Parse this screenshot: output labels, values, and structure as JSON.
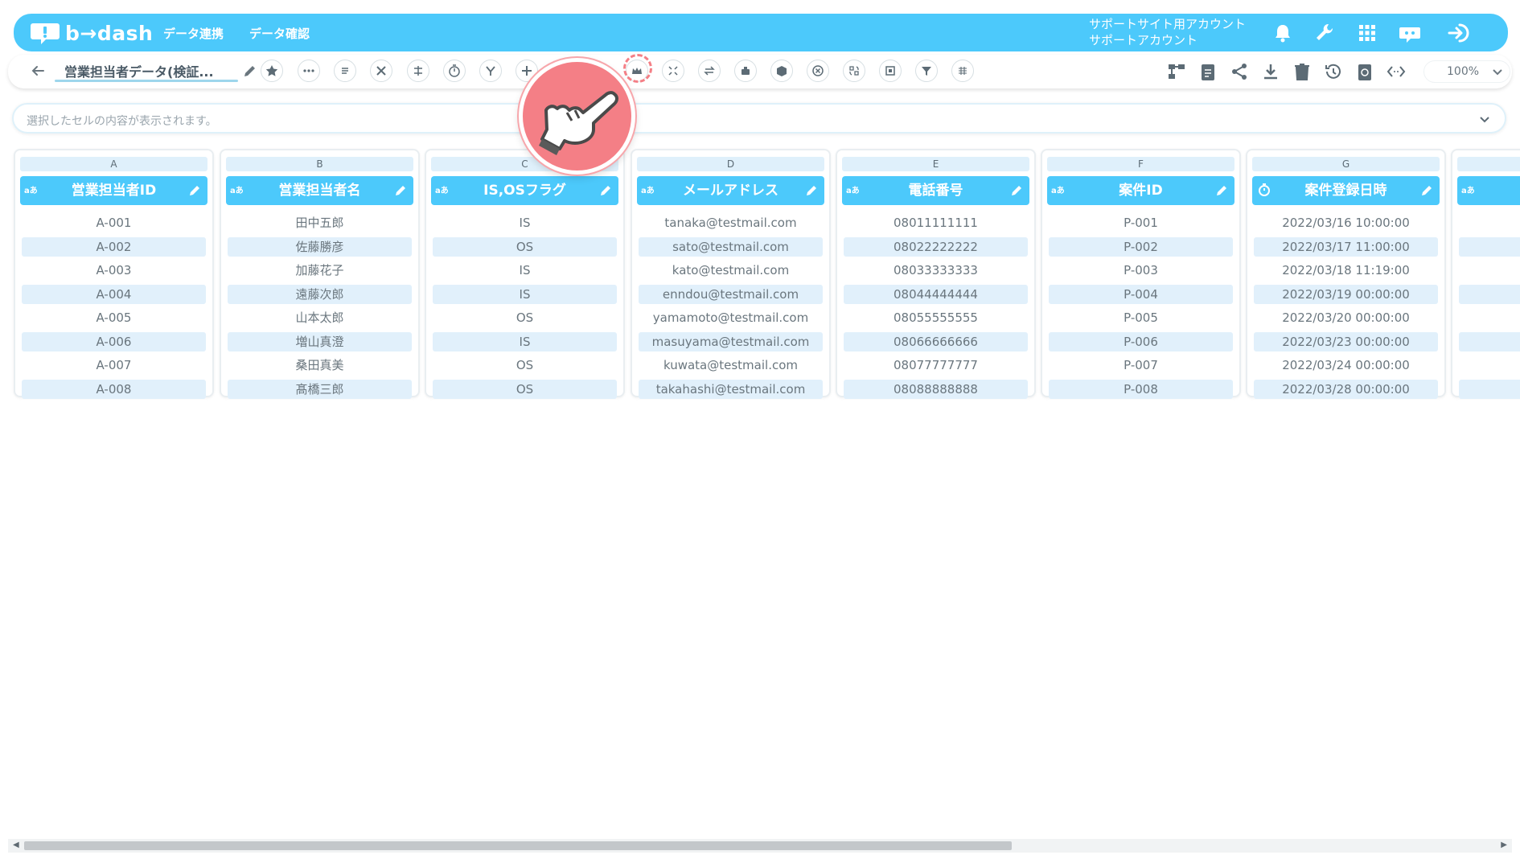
{
  "header": {
    "logo_text": "b→dash",
    "nav": [
      "データ連携",
      "データ確認"
    ],
    "account_line1": "サポートサイト用アカウント",
    "account_line2": "サポートアカウント",
    "icons": [
      "bell-icon",
      "wrench-icon",
      "apps-grid-icon",
      "chat-robot-icon",
      "logout-icon"
    ]
  },
  "toolbar": {
    "title": "営業担当者データ(検証...",
    "zoom": "100%",
    "left_icons": [
      "star-icon",
      "more-icon",
      "list-icon",
      "tools-icon",
      "merge-icon",
      "timer-icon",
      "branch-icon",
      "plus-icon",
      "link-icon",
      "crown-icon",
      "expand-icon",
      "swap-icon",
      "combine-icon",
      "box-icon",
      "cancel-icon",
      "replace-icon",
      "frame-icon",
      "filter-icon",
      "calendar-icon"
    ],
    "right_icons": [
      "flow-icon",
      "clipboard-icon",
      "share-icon",
      "download-icon",
      "trash-icon",
      "history-icon",
      "refresh-doc-icon",
      "code-icon"
    ]
  },
  "formula_bar": {
    "placeholder": "選択したセルの内容が表示されます。"
  },
  "columns": [
    {
      "letter": "A",
      "type": "aあ",
      "name": "営業担当者ID",
      "values": [
        "A-001",
        "A-002",
        "A-003",
        "A-004",
        "A-005",
        "A-006",
        "A-007",
        "A-008"
      ]
    },
    {
      "letter": "B",
      "type": "aあ",
      "name": "営業担当者名",
      "values": [
        "田中五郎",
        "佐藤勝彦",
        "加藤花子",
        "遠藤次郎",
        "山本太郎",
        "増山真澄",
        "桑田真美",
        "髙橋三郎"
      ]
    },
    {
      "letter": "C",
      "type": "aあ",
      "name": "IS,OSフラグ",
      "values": [
        "IS",
        "OS",
        "IS",
        "IS",
        "OS",
        "IS",
        "OS",
        "OS"
      ]
    },
    {
      "letter": "D",
      "type": "aあ",
      "name": "メールアドレス",
      "values": [
        "tanaka@testmail.com",
        "sato@testmail.com",
        "kato@testmail.com",
        "enndou@testmail.com",
        "yamamoto@testmail.com",
        "masuyama@testmail.com",
        "kuwata@testmail.com",
        "takahashi@testmail.com"
      ]
    },
    {
      "letter": "E",
      "type": "aあ",
      "name": "電話番号",
      "values": [
        "08011111111",
        "08022222222",
        "08033333333",
        "08044444444",
        "08055555555",
        "08066666666",
        "08077777777",
        "08088888888"
      ]
    },
    {
      "letter": "F",
      "type": "aあ",
      "name": "案件ID",
      "values": [
        "P-001",
        "P-002",
        "P-003",
        "P-004",
        "P-005",
        "P-006",
        "P-007",
        "P-008"
      ]
    },
    {
      "letter": "G",
      "type": "clock",
      "name": "案件登録日時",
      "values": [
        "2022/03/16 10:00:00",
        "2022/03/17 11:00:00",
        "2022/03/18 11:19:00",
        "2022/03/19 00:00:00",
        "2022/03/20 00:00:00",
        "2022/03/23 00:00:00",
        "2022/03/24 00:00:00",
        "2022/03/28 00:00:00"
      ]
    },
    {
      "letter": "",
      "type": "aあ",
      "name": "",
      "values": [
        "",
        "",
        "",
        "",
        "",
        "",
        "",
        ""
      ]
    }
  ],
  "colors": {
    "accent": "#4cc9fb",
    "row_alt": "#e1f0fb",
    "pointer": "#f47f86"
  }
}
